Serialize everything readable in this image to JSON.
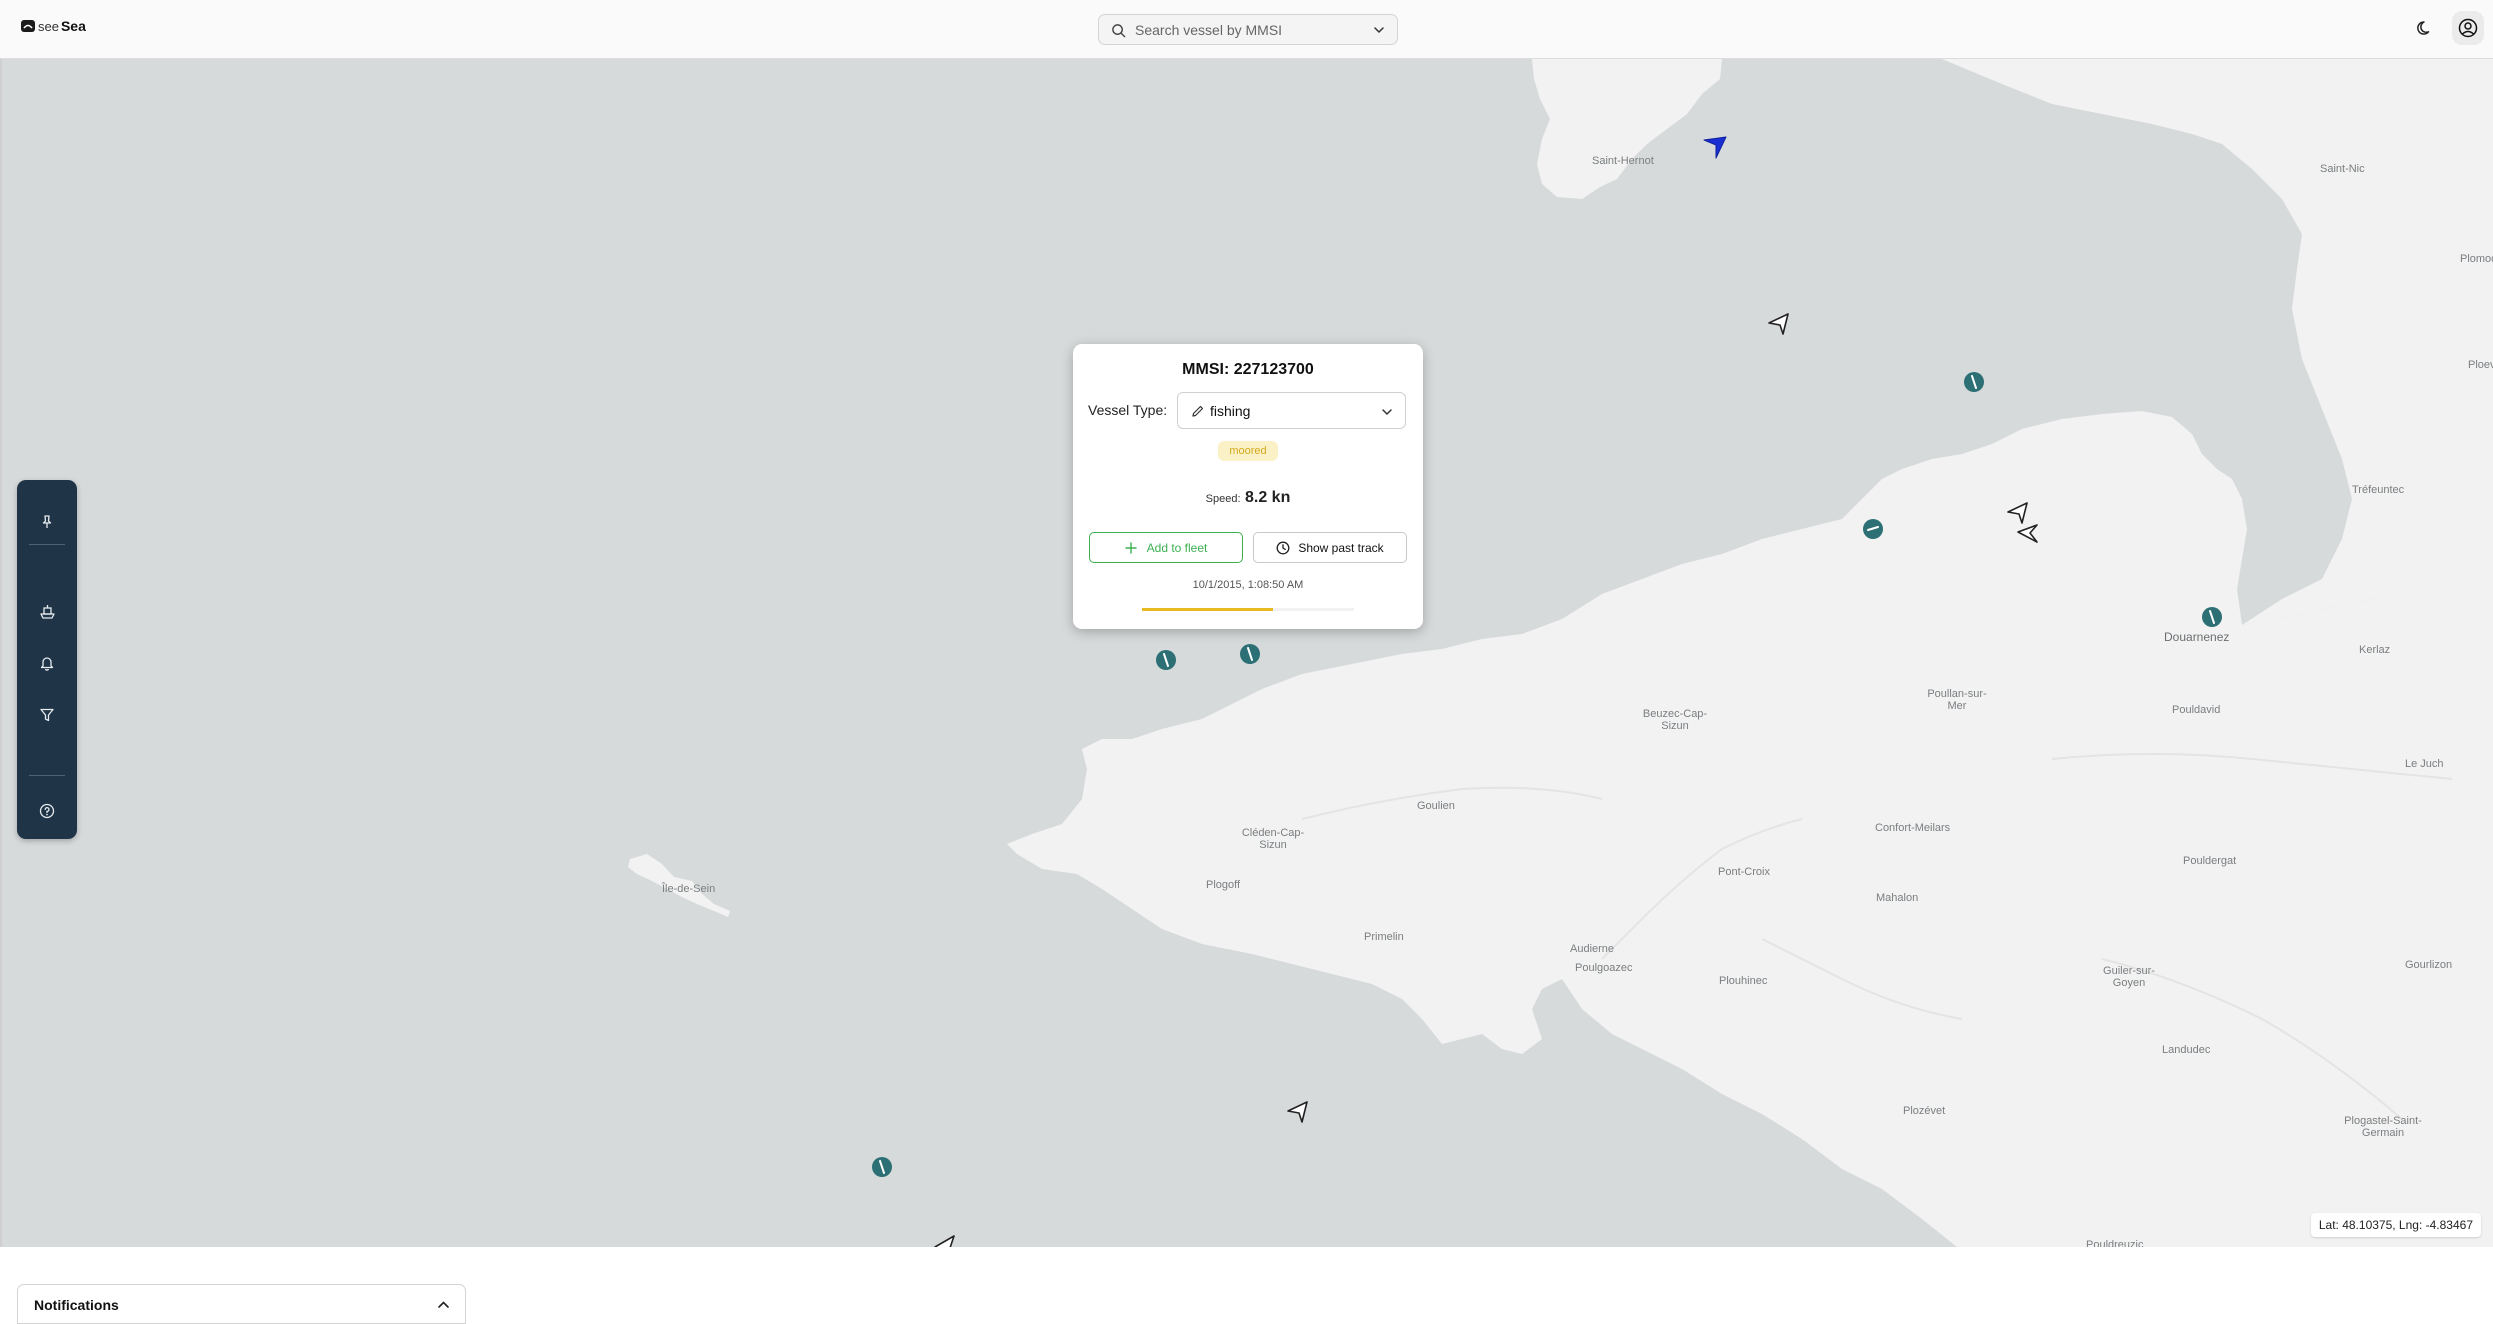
{
  "app": {
    "name_prefix": "see",
    "name_suffix": "Sea"
  },
  "header": {
    "search_placeholder": "Search vessel by MMSI",
    "icons": [
      "search-icon",
      "chevron-down-icon",
      "moon-icon",
      "user-icon"
    ]
  },
  "sidebar": {
    "icons": [
      "pin-icon",
      "ship-icon",
      "bell-icon",
      "filter-icon",
      "help-icon"
    ]
  },
  "map": {
    "places": [
      "Saint-Hernot",
      "Saint-Nic",
      "Plomodi",
      "Ploeve",
      "Tréfeuntec",
      "Douarnenez",
      "Kerlaz",
      "Poullan-sur-Mer",
      "Pouldavid",
      "Beuzec-Cap-Sizun",
      "Le Juch",
      "Goulien",
      "Cléden-Cap-Sizun",
      "Confort-Meilars",
      "Pont-Croix",
      "Pouldergat",
      "Plogoff",
      "Mahalon",
      "Île-de-Sein",
      "Primelin",
      "Audierne",
      "Poulgoazec",
      "Plouhinec",
      "Guiler-sur-Goyen",
      "Gourlizon",
      "Landudec",
      "Plozévet",
      "Plogastel-Saint-Germain",
      "Pouldreuzic"
    ],
    "coords_readout": "Lat: 48.10375, Lng: -4.83467"
  },
  "popup": {
    "title": "MMSI: 227123700",
    "vessel_type_label": "Vessel Type:",
    "vessel_type_value": "fishing",
    "status_badge": "moored",
    "speed_label": "Speed:",
    "speed_value": "8.2 kn",
    "add_fleet_label": "Add to fleet",
    "show_track_label": "Show past track",
    "timestamp": "10/1/2015, 1:08:50 AM",
    "progress_fraction": 0.62,
    "colors": {
      "accent_green": "#3cb053",
      "badge_yellow": "#d4a91c",
      "progress": "#e8b923"
    }
  },
  "notifications": {
    "title": "Notifications"
  }
}
